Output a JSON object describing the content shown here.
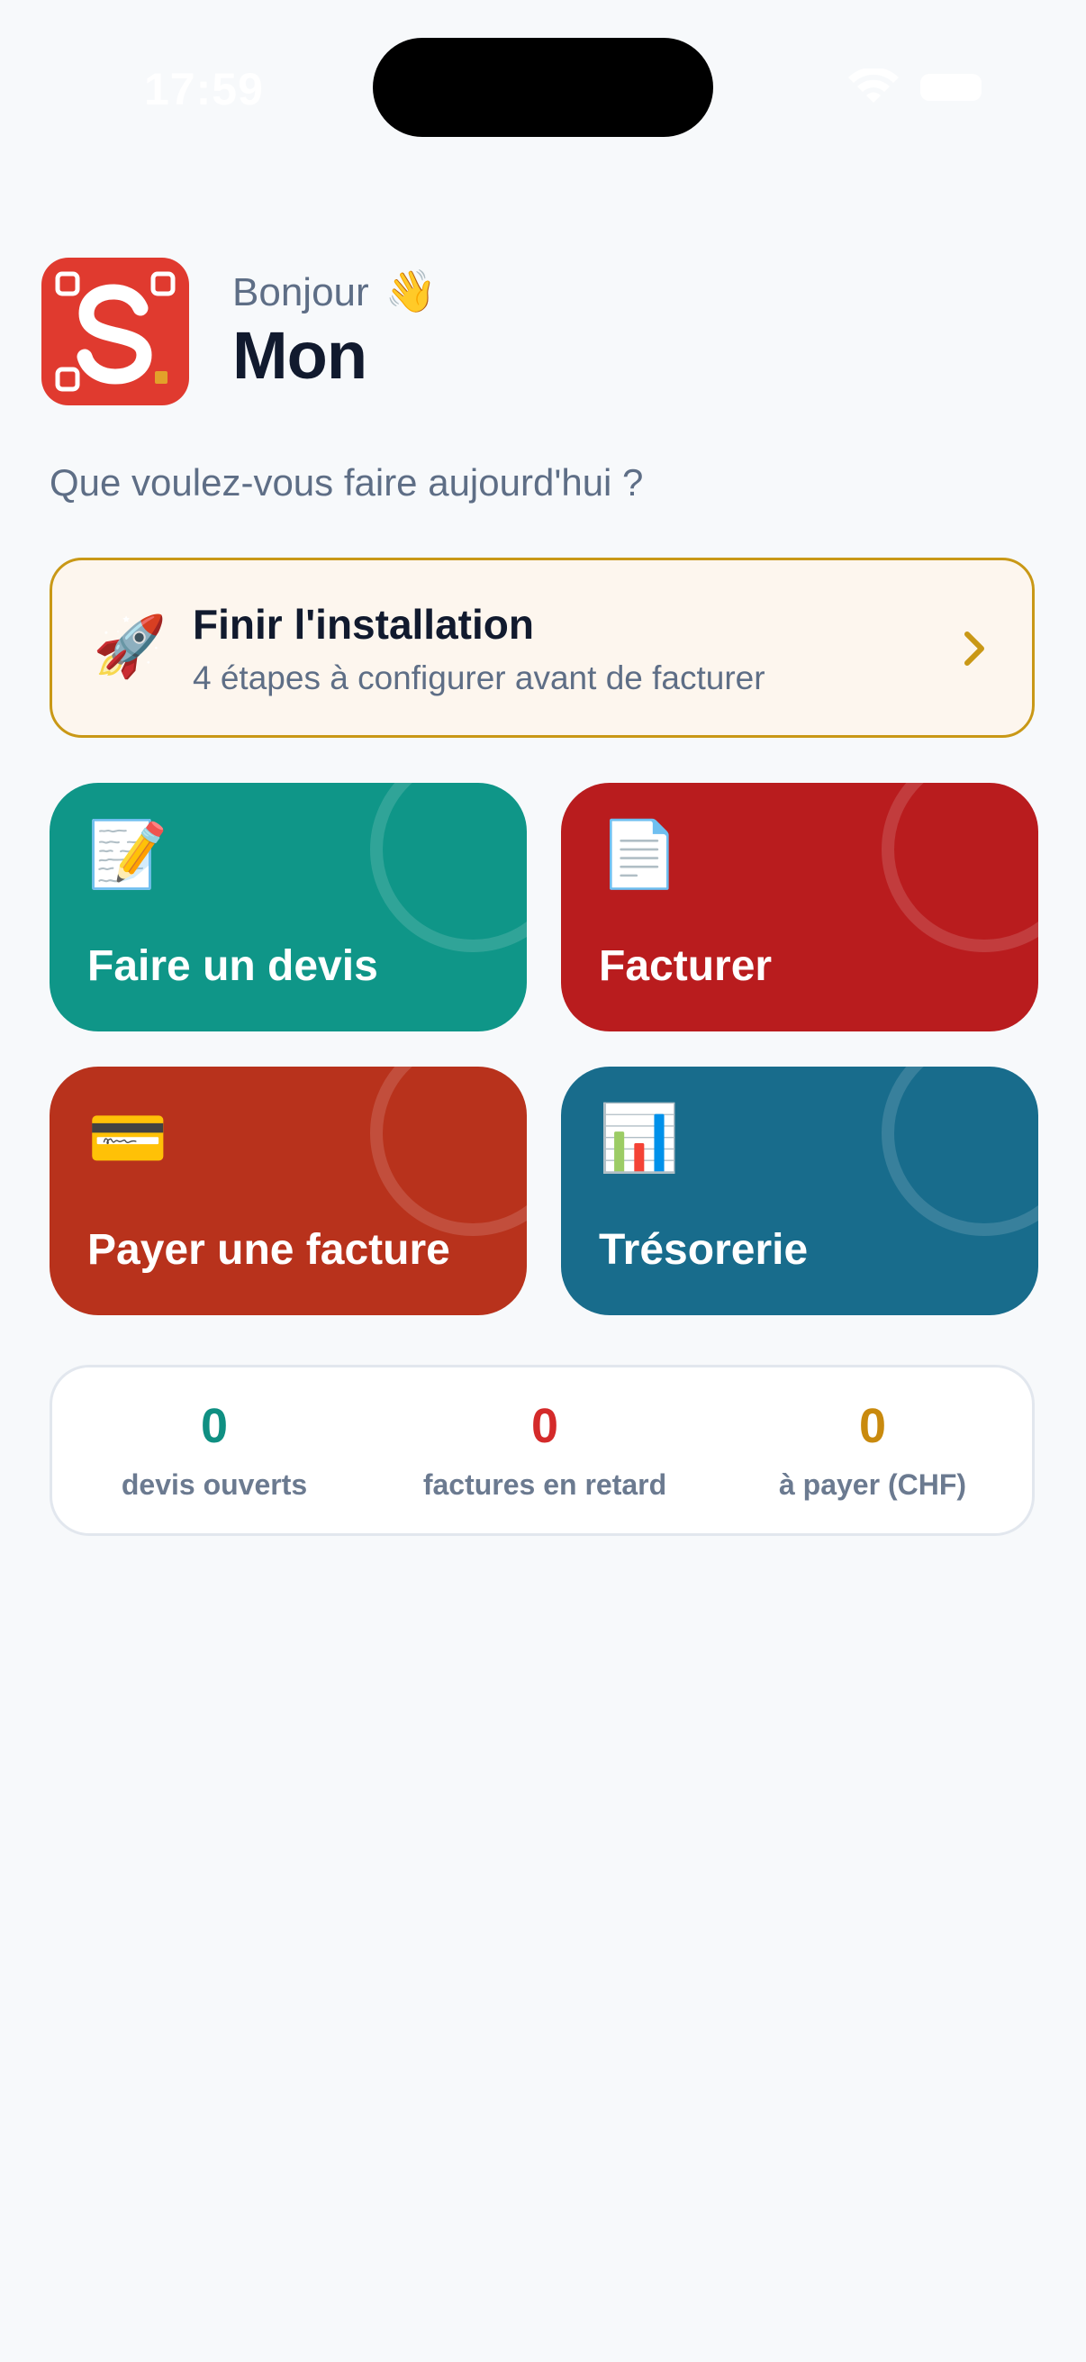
{
  "status_bar": {
    "time": "17:59"
  },
  "header": {
    "greeting": "Bonjour",
    "greeting_emoji": "👋",
    "user_name": "Mon",
    "subtitle": "Que voulez-vous faire aujourd'hui ?"
  },
  "setup_card": {
    "icon": "🚀",
    "title": "Finir l'installation",
    "description": "4 étapes à configurer avant de facturer"
  },
  "actions": [
    {
      "label": "Faire un devis",
      "icon": "📝",
      "color": "#0f9688"
    },
    {
      "label": "Facturer",
      "icon": "📄",
      "color": "#b91c1e"
    },
    {
      "label": "Payer une facture",
      "icon": "💳",
      "color": "#b8321c"
    },
    {
      "label": "Trésorerie",
      "icon": "📊",
      "color": "#186c8c"
    }
  ],
  "stats": [
    {
      "value": "0",
      "label": "devis ouverts",
      "color": "#0f8f82"
    },
    {
      "value": "0",
      "label": "factures en retard",
      "color": "#d42a2a"
    },
    {
      "value": "0",
      "label": "à payer (CHF)",
      "color": "#c98a0e"
    }
  ],
  "colors": {
    "brand_red": "#e03a2f",
    "setup_border": "#c99816",
    "background": "#f7f9fb"
  }
}
